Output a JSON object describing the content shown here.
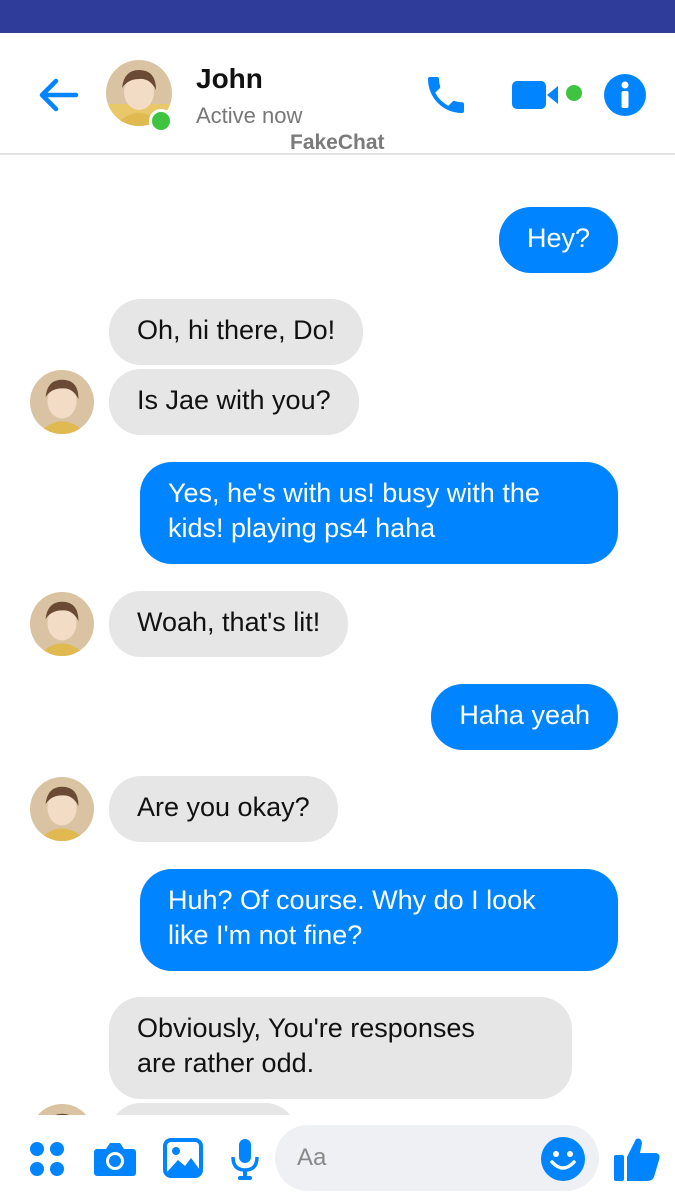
{
  "header": {
    "contact_name": "John",
    "status": "Active now",
    "watermark": "FakeChat",
    "icons": {
      "back": "back-arrow-icon",
      "call": "phone-icon",
      "video": "video-camera-icon",
      "info": "info-icon"
    }
  },
  "messages": [
    {
      "from": "me",
      "text": "Hey?"
    },
    {
      "from": "John",
      "text": "Oh, hi there, Do!"
    },
    {
      "from": "John",
      "text": "Is Jae with you?"
    },
    {
      "from": "me",
      "text": "Yes, he's with us! busy with the\nkids!  playing ps4 haha"
    },
    {
      "from": "John",
      "text": "Woah,  that's lit!"
    },
    {
      "from": "me",
      "text": "Haha yeah"
    },
    {
      "from": "John",
      "text": "Are you okay?"
    },
    {
      "from": "me",
      "text": "Huh?  Of course.  Why do I look\nlike I'm not fine?"
    },
    {
      "from": "John",
      "text": "Obviously,  You're responses\nare rather odd."
    }
  ],
  "composer": {
    "placeholder": "Aa",
    "icons": [
      "apps-grid-icon",
      "camera-icon",
      "image-icon",
      "microphone-icon",
      "emoji-icon",
      "thumbs-up-icon"
    ]
  },
  "colors": {
    "accent": "#0084ff",
    "status_bar": "#2f3c9a",
    "incoming_bubble": "#e6e6e6",
    "online": "#3fc43f"
  }
}
